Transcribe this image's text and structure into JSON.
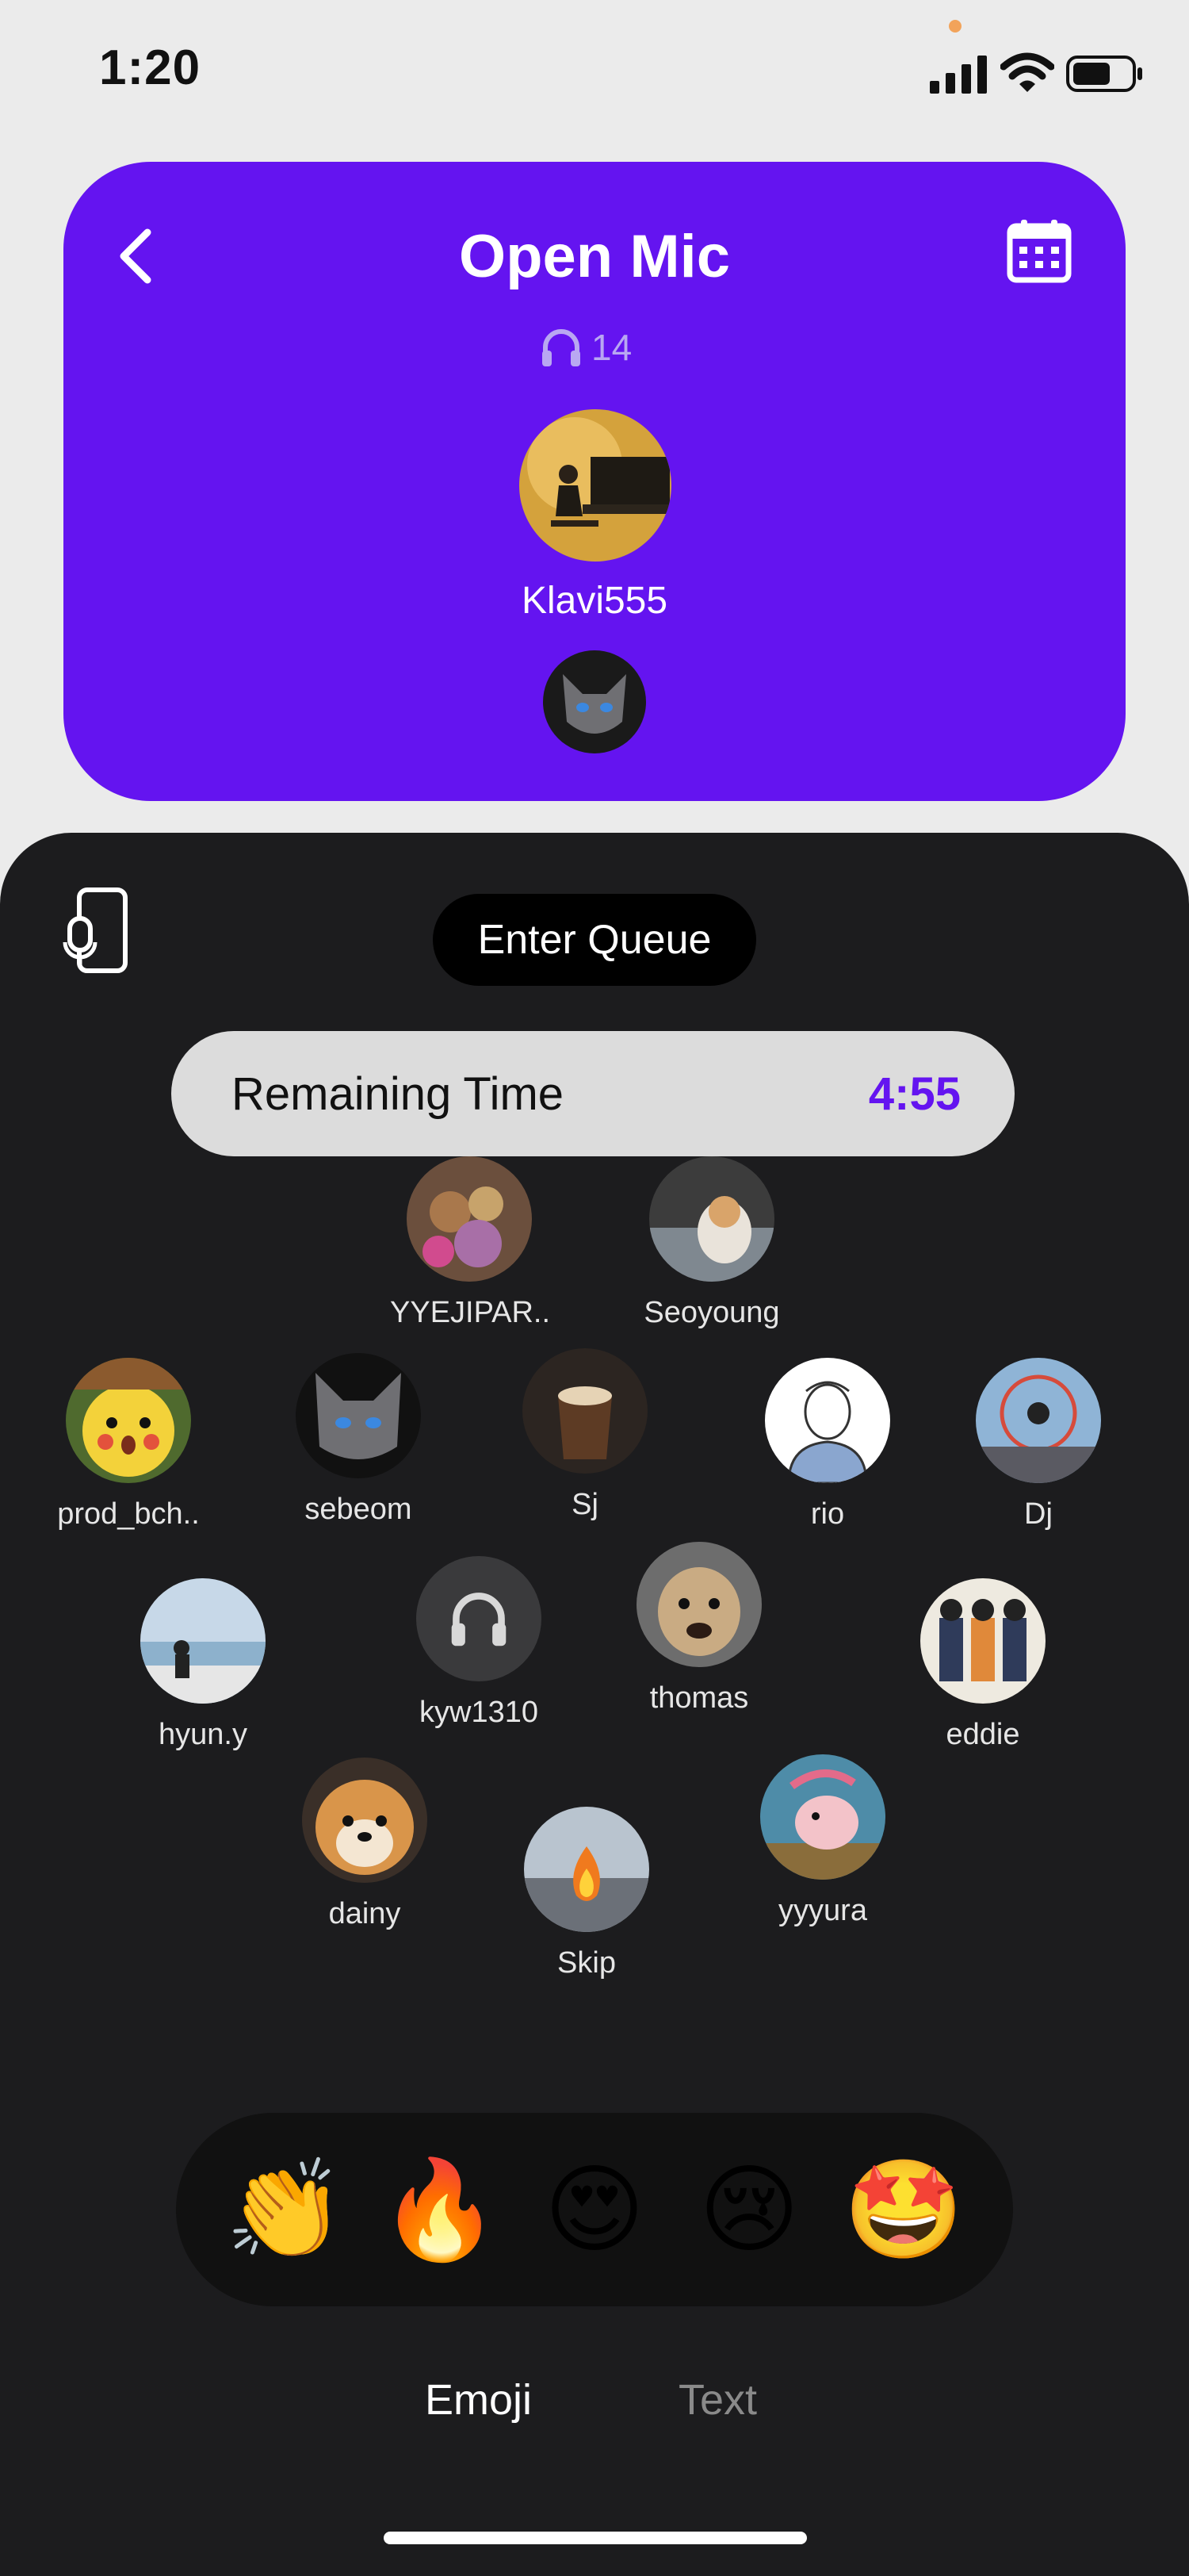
{
  "status_bar": {
    "time": "1:20"
  },
  "header": {
    "title": "Open Mic",
    "listener_count": "14",
    "host_name": "Klavi555"
  },
  "queue": {
    "enter_label": "Enter Queue",
    "remaining_label": "Remaining Time",
    "remaining_value": "4:55"
  },
  "listeners": [
    {
      "name": "YYEJIPAR..",
      "avatar": "stuffed-toys"
    },
    {
      "name": "Seoyoung",
      "avatar": "cat-photo"
    },
    {
      "name": "prod_bch..",
      "avatar": "pikachu"
    },
    {
      "name": "sebeom",
      "avatar": "gray-cat"
    },
    {
      "name": "Sj",
      "avatar": "coffee"
    },
    {
      "name": "rio",
      "avatar": "sketch-man"
    },
    {
      "name": "Dj",
      "avatar": "ferris-wheel"
    },
    {
      "name": "hyun.y",
      "avatar": "beach"
    },
    {
      "name": "kyw1310",
      "avatar": "headphones"
    },
    {
      "name": "thomas",
      "avatar": "dog"
    },
    {
      "name": "eddie",
      "avatar": "cartoon-group"
    },
    {
      "name": "dainy",
      "avatar": "pomeranian"
    },
    {
      "name": "Skip",
      "avatar": "fire-building"
    },
    {
      "name": "yyyura",
      "avatar": "cartoon-pig"
    }
  ],
  "emojis": [
    "👏",
    "🔥",
    "😍",
    "😢",
    "🤩"
  ],
  "tabs": {
    "emoji": "Emoji",
    "text": "Text"
  },
  "colors": {
    "accent": "#6414f0",
    "sheet": "#1c1c1e",
    "pill": "#dcdcdc"
  }
}
